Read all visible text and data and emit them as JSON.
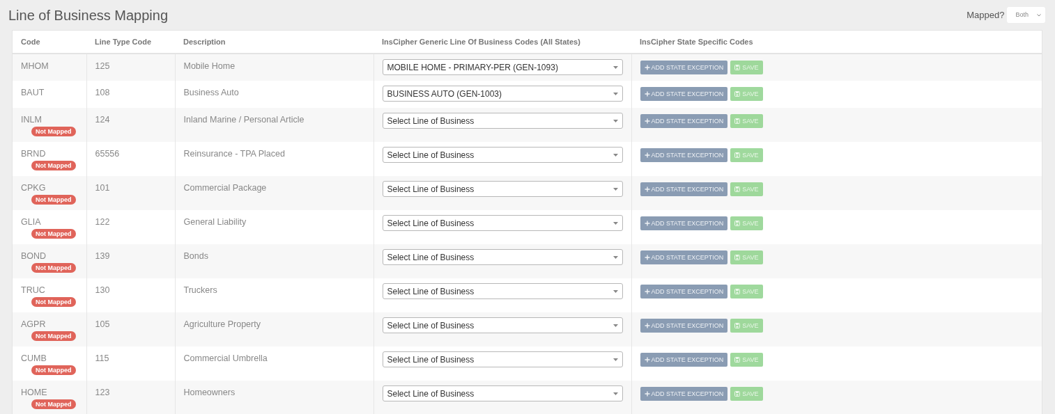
{
  "title": "Line of Business Mapping",
  "filter": {
    "label": "Mapped?",
    "value": "Both"
  },
  "table": {
    "columns": [
      "Code",
      "Line Type Code",
      "Description",
      "InsCipher Generic Line Of Business Codes (All States)",
      "InsCipher State Specific Codes"
    ],
    "rows": [
      {
        "code": "MHOM",
        "line_type_code": "125",
        "description": "Mobile Home",
        "selection": "MOBILE HOME - PRIMARY-PER (GEN-1093)",
        "add_label": "ADD STATE EXCEPTION",
        "save_label": "SAVE",
        "save_disabled": true
      },
      {
        "code": "BAUT",
        "line_type_code": "108",
        "description": "Business Auto",
        "selection": "BUSINESS AUTO (GEN-1003)",
        "add_label": "ADD STATE EXCEPTION",
        "save_label": "SAVE",
        "save_disabled": true
      },
      {
        "code": "INLM",
        "badge": "Not Mapped",
        "line_type_code": "124",
        "description": "Inland Marine / Personal Article",
        "selection": "Select Line of Business",
        "add_label": "ADD STATE EXCEPTION",
        "save_label": "SAVE",
        "save_disabled": true
      },
      {
        "code": "BRND",
        "badge": "Not Mapped",
        "line_type_code": "65556",
        "description": "Reinsurance - TPA Placed",
        "selection": "Select Line of Business",
        "add_label": "ADD STATE EXCEPTION",
        "save_label": "SAVE",
        "save_disabled": true
      },
      {
        "code": "CPKG",
        "badge": "Not Mapped",
        "line_type_code": "101",
        "description": "Commercial Package",
        "selection": "Select Line of Business",
        "add_label": "ADD STATE EXCEPTION",
        "save_label": "SAVE",
        "save_disabled": true
      },
      {
        "code": "GLIA",
        "badge": "Not Mapped",
        "line_type_code": "122",
        "description": "General Liability",
        "selection": "Select Line of Business",
        "add_label": "ADD STATE EXCEPTION",
        "save_label": "SAVE",
        "save_disabled": true
      },
      {
        "code": "BOND",
        "badge": "Not Mapped",
        "line_type_code": "139",
        "description": "Bonds",
        "selection": "Select Line of Business",
        "add_label": "ADD STATE EXCEPTION",
        "save_label": "SAVE",
        "save_disabled": true
      },
      {
        "code": "TRUC",
        "badge": "Not Mapped",
        "line_type_code": "130",
        "description": "Truckers",
        "selection": "Select Line of Business",
        "add_label": "ADD STATE EXCEPTION",
        "save_label": "SAVE",
        "save_disabled": true
      },
      {
        "code": "AGPR",
        "badge": "Not Mapped",
        "line_type_code": "105",
        "description": "Agriculture Property",
        "selection": "Select Line of Business",
        "add_label": "ADD STATE EXCEPTION",
        "save_label": "SAVE",
        "save_disabled": true
      },
      {
        "code": "CUMB",
        "badge": "Not Mapped",
        "line_type_code": "115",
        "description": "Commercial Umbrella",
        "selection": "Select Line of Business",
        "add_label": "ADD STATE EXCEPTION",
        "save_label": "SAVE",
        "save_disabled": true
      },
      {
        "code": "HOME",
        "badge": "Not Mapped",
        "line_type_code": "123",
        "description": "Homeowners",
        "selection": "Select Line of Business",
        "add_label": "ADD STATE EXCEPTION",
        "save_label": "SAVE",
        "save_disabled": true
      }
    ]
  }
}
